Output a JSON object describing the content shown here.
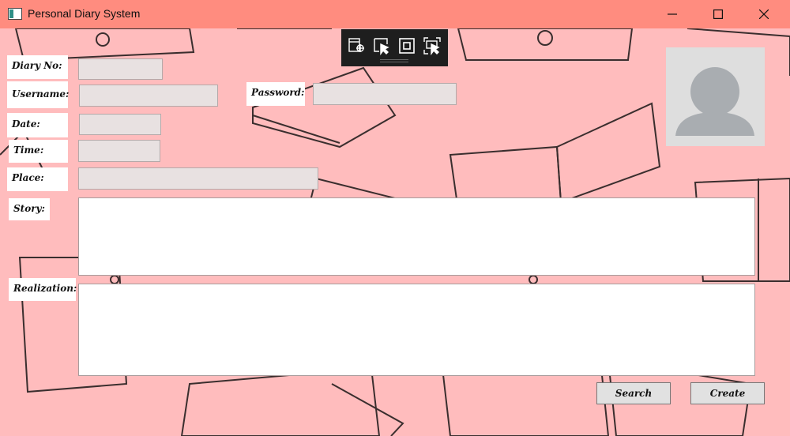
{
  "window": {
    "title": "Personal Diary System",
    "accent_color": "#ff8c7f",
    "background_color": "#ffbcbd"
  },
  "form": {
    "diary_no_label": "Diary No:",
    "username_label": "Username:",
    "password_label": "Password:",
    "date_label": "Date:",
    "time_label": "Time:",
    "place_label": "Place:",
    "story_label": "Story:",
    "realization_label": "Realization:",
    "diary_no_value": "",
    "username_value": "",
    "password_value": "",
    "date_value": "",
    "time_value": "",
    "place_value": "",
    "story_value": "",
    "realization_value": ""
  },
  "buttons": {
    "search_label": "Search",
    "create_label": "Create"
  },
  "icons": {
    "profile": "user-silhouette-icon",
    "minimize": "minimize-icon",
    "maximize": "maximize-icon",
    "close": "close-icon"
  }
}
